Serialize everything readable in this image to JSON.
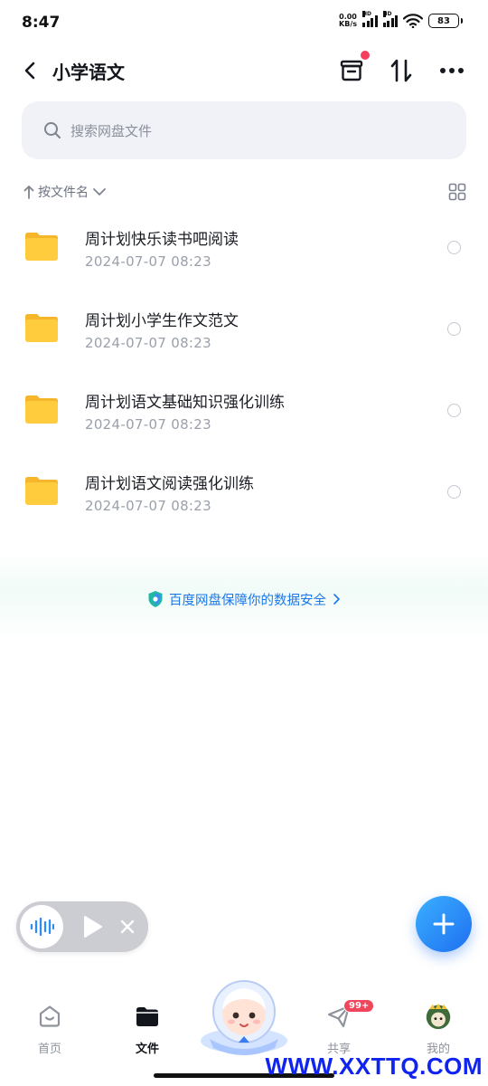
{
  "status_bar": {
    "time": "8:47",
    "net_speed_value": "0.00",
    "net_speed_unit": "KB/s",
    "signal_label_1": "HD",
    "signal_label_2": "HD",
    "battery": "83"
  },
  "header": {
    "title": "小学语文"
  },
  "search": {
    "placeholder": "搜索网盘文件"
  },
  "sort": {
    "label": "按文件名"
  },
  "files": [
    {
      "name": "周计划快乐读书吧阅读",
      "date": "2024-07-07  08:23"
    },
    {
      "name": "周计划小学生作文范文",
      "date": "2024-07-07  08:23"
    },
    {
      "name": "周计划语文基础知识强化训练",
      "date": "2024-07-07  08:23"
    },
    {
      "name": "周计划语文阅读强化训练",
      "date": "2024-07-07  08:23"
    }
  ],
  "security": {
    "text": "百度网盘保障你的数据安全"
  },
  "bottom_nav": {
    "home": "首页",
    "files": "文件",
    "share": "共享",
    "share_badge": "99+",
    "mine": "我的"
  },
  "watermark": "WWW.XXTTQ.COM",
  "colors": {
    "accent": "#1b78e8",
    "folder": "#ffc83a",
    "badge": "#f0455a",
    "fab": "#2b8ef8"
  },
  "icons": [
    "back-icon",
    "archive-icon",
    "sort-arrows-icon",
    "more-icon",
    "search-icon",
    "grid-view-icon",
    "folder-icon",
    "shield-icon",
    "waveform-icon",
    "play-icon",
    "close-icon",
    "plus-icon",
    "home-icon",
    "files-icon",
    "share-icon",
    "avatar"
  ]
}
